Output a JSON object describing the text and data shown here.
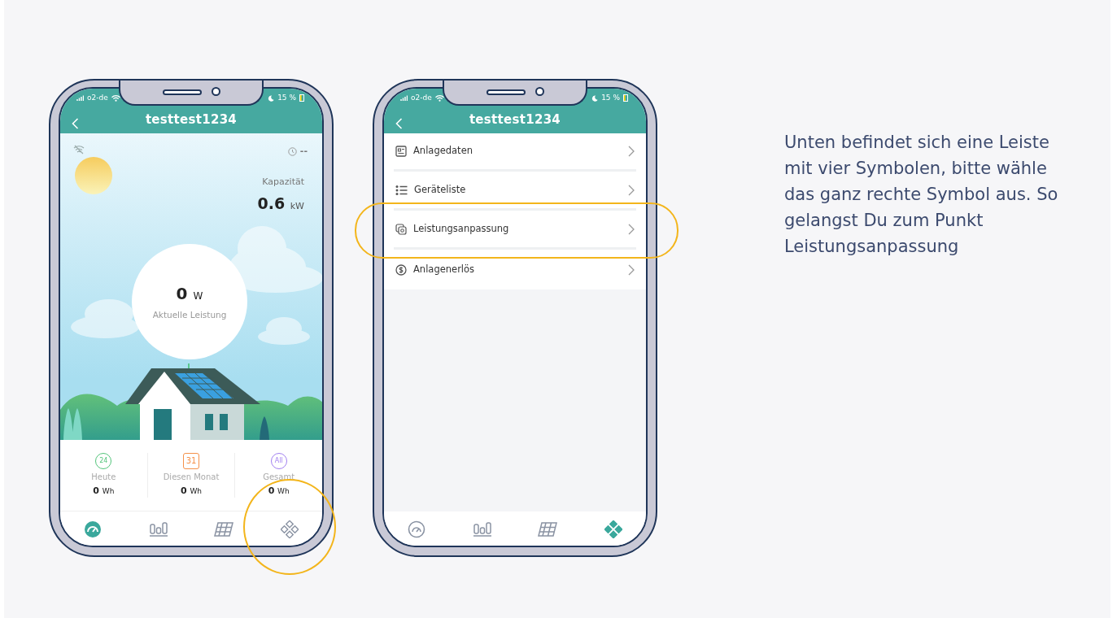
{
  "phones": [
    {
      "kind": "dashboard",
      "status_bar": {
        "carrier": "o2-de",
        "battery": "15 %"
      },
      "title": "testtest1234",
      "dashboard": {
        "update_time": "--",
        "capacity_label": "Kapazität",
        "capacity_value": "0.6",
        "capacity_unit": "kW",
        "power_value": "0",
        "power_unit": "W",
        "power_label": "Aktuelle Leistung",
        "stats": [
          {
            "kind": "day",
            "badge": "24",
            "color": "#52c47a",
            "label": "Heute",
            "value": "0",
            "unit": "Wh"
          },
          {
            "kind": "month",
            "badge": "31",
            "color": "#f5914a",
            "label": "Diesen Monat",
            "value": "0",
            "unit": "Wh"
          },
          {
            "kind": "total",
            "badge": "All",
            "color": "#a07ef0",
            "label": "Gesamt",
            "value": "0",
            "unit": "Wh"
          }
        ]
      },
      "tabs": [
        {
          "kind": "gauge",
          "selected": true,
          "highlighted": false
        },
        {
          "kind": "chart",
          "selected": false,
          "highlighted": false
        },
        {
          "kind": "panel",
          "selected": false,
          "highlighted": false
        },
        {
          "kind": "device",
          "selected": false,
          "highlighted": true
        }
      ]
    },
    {
      "kind": "menu",
      "status_bar": {
        "carrier": "o2-de",
        "battery": "15 %"
      },
      "title": "testtest1234",
      "menu": [
        {
          "kind": "data",
          "label": "Anlagedaten",
          "highlighted": false
        },
        {
          "kind": "list",
          "label": "Geräteliste",
          "highlighted": false
        },
        {
          "kind": "adjust",
          "label": "Leistungsanpassung",
          "highlighted": true
        },
        {
          "kind": "revenue",
          "label": "Anlagenerlös",
          "highlighted": false
        }
      ],
      "tabs": [
        {
          "kind": "gauge",
          "selected": false,
          "highlighted": false
        },
        {
          "kind": "chart",
          "selected": false,
          "highlighted": false
        },
        {
          "kind": "panel",
          "selected": false,
          "highlighted": false
        },
        {
          "kind": "device",
          "selected": true,
          "highlighted": false
        }
      ]
    }
  ],
  "caption": "Unten befindet sich eine Leiste mit vier Symbolen, bitte wähle das ganz rechte Symbol aus. So gelangst Du zum Punkt Leistungsanpassung"
}
